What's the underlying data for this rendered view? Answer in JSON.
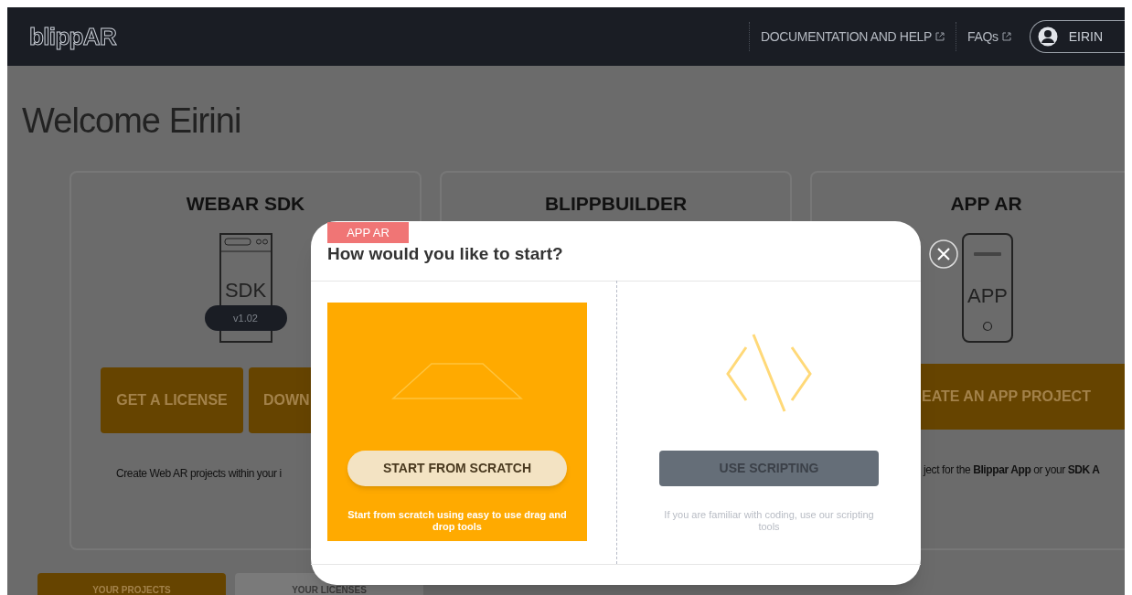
{
  "header": {
    "logo": "blippAR",
    "links": [
      {
        "label": "DOCUMENTATION AND HELP"
      },
      {
        "label": "FAQs"
      }
    ],
    "user": "EIRIN"
  },
  "welcome": "Welcome Eirini",
  "cards": [
    {
      "kind": "sdk",
      "title": "WEBAR SDK",
      "icon_label": "SDK",
      "version": "v1.02",
      "buttons": [
        "GET A LICENSE",
        "DOWN"
      ],
      "description": "Create Web AR projects within your i"
    },
    {
      "kind": "builder",
      "title": "BLIPPBUILDER"
    },
    {
      "kind": "app",
      "title": "APP AR",
      "icon_label": "APP",
      "buttons": [
        "EATE AN APP PROJECT"
      ],
      "description": "ject for the **Blippar App** or your **SDK A**"
    }
  ],
  "tabs": [
    {
      "label": "YOUR PROJECTS",
      "selected": true
    },
    {
      "label": "YOUR LICENSES",
      "selected": false
    }
  ],
  "modal": {
    "tag": "APP AR",
    "title": "How would you like to start?",
    "options": [
      {
        "kind": "builder",
        "button": "START FROM SCRATCH",
        "description": "Start from scratch using easy to use drag and drop tools"
      },
      {
        "kind": "scripting",
        "button": "USE SCRIPTING",
        "description": "If you are familiar with coding, use our scripting tools"
      }
    ]
  }
}
